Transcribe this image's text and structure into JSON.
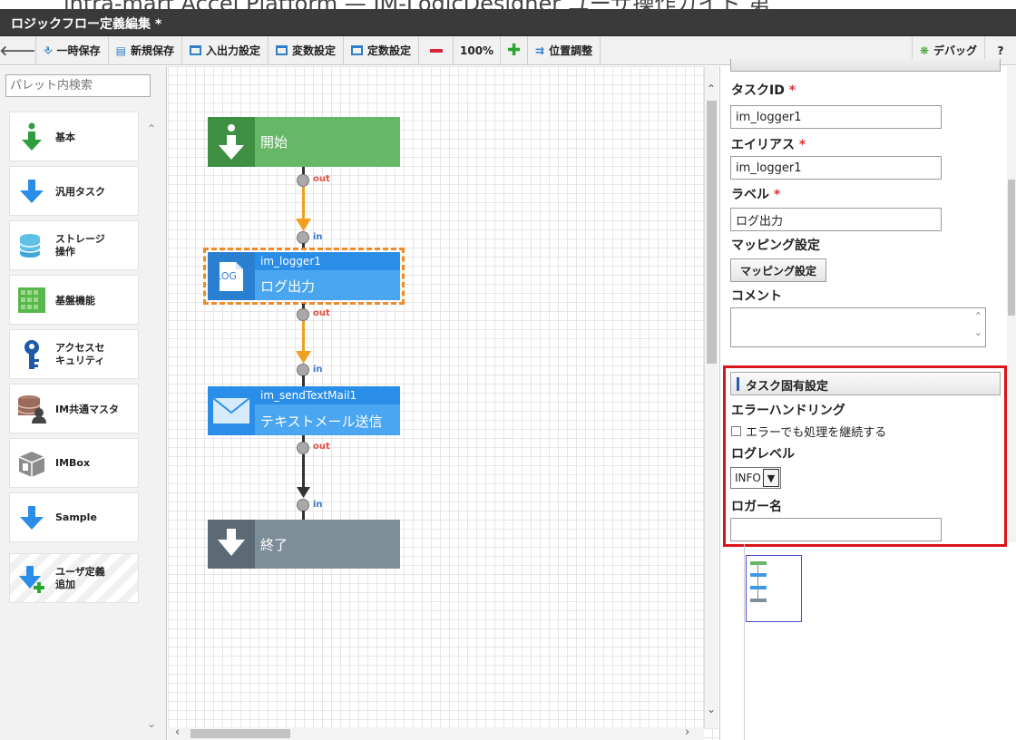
{
  "window": {
    "partial_header": "intra-mart Accel Platform — IM-LogicDesigner ユーザ操作ガイド 第",
    "title": "ロジックフロー定義編集 *"
  },
  "toolbar": {
    "back_icon": "arrow-left-icon",
    "temp_save": "一時保存",
    "new_save": "新規保存",
    "io_settings": "入出力設定",
    "var_settings": "変数設定",
    "const_settings": "定数設定",
    "zoom": "100%",
    "align": "位置調整",
    "debug": "デバッグ",
    "help": "?"
  },
  "palette": {
    "search_placeholder": "パレット内検索",
    "items": [
      {
        "label": "基本",
        "icon": "arrow-down-icon"
      },
      {
        "label": "汎用タスク",
        "icon": "arrow-down-icon"
      },
      {
        "label": "ストレージ操作",
        "icon": "storage-icon"
      },
      {
        "label": "基盤機能",
        "icon": "grid-icon"
      },
      {
        "label": "アクセスセキュリティ",
        "icon": "key-icon"
      },
      {
        "label": "IM共通マスタ",
        "icon": "database-user-icon"
      },
      {
        "label": "IMBox",
        "icon": "box-icon"
      },
      {
        "label": "Sample",
        "icon": "arrow-down-icon"
      },
      {
        "label": "ユーザ定義追加",
        "icon": "add-arrow-icon"
      }
    ]
  },
  "flow": {
    "start_label": "開始",
    "logger_id": "im_logger1",
    "logger_label": "ログ出力",
    "logger_icon_text": "LOG",
    "mail_id": "im_sendTextMail1",
    "mail_label": "テキストメール送信",
    "end_label": "終了",
    "port_out": "out",
    "port_in": "in",
    "colors": {
      "start": "#66b868",
      "start_dark": "#3f8f42",
      "task": "#3b9be8",
      "task_dark": "#2a7fd0",
      "end": "#7e8e99",
      "end_dark": "#5b6a74",
      "arrow_orange": "#f0a020",
      "arrow_dark": "#333333",
      "selection": "#f08a24"
    }
  },
  "properties": {
    "task_id_label": "タスクID",
    "task_id_value": "im_logger1",
    "alias_label": "エイリアス",
    "alias_value": "im_logger1",
    "label_label": "ラベル",
    "label_value": "ログ出力",
    "required_mark": "*",
    "mapping_label": "マッピング設定",
    "mapping_button": "マッピング設定",
    "comment_label": "コメント",
    "section_title": "タスク固有設定",
    "error_handling_label": "エラーハンドリング",
    "continue_on_error": "エラーでも処理を継続する",
    "log_level_label": "ログレベル",
    "log_level_value": "INFO",
    "logger_name_label": "ロガー名",
    "logger_name_value": ""
  }
}
